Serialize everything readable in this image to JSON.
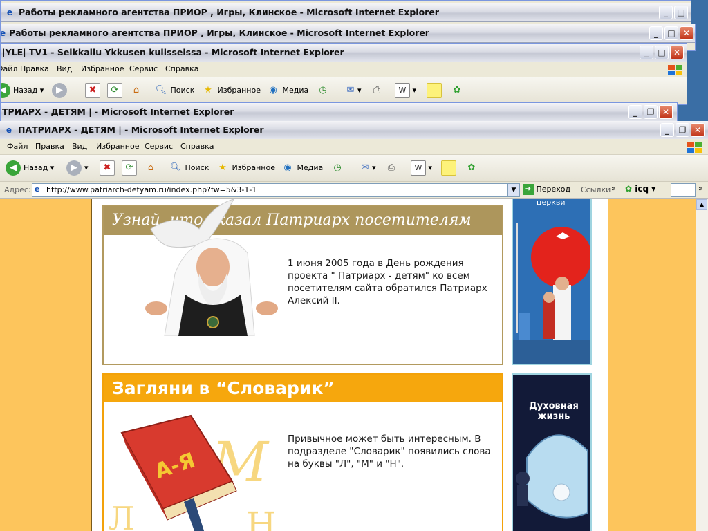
{
  "windows": {
    "w1": {
      "title": "Работы рекламного агентства ПРИОР , Игры, Клинское - Microsoft Internet Explorer"
    },
    "w2": {
      "title": "Работы рекламного агентства ПРИОР , Игры, Клинское - Microsoft Internet Explorer"
    },
    "w3": {
      "title": "|YLE| TV1 - Seikkailu Ykkusen kulisseissa - Microsoft Internet Explorer"
    },
    "w4": {
      "title": "ТРИАРХ - ДЕТЯМ | - Microsoft Internet Explorer"
    },
    "w5": {
      "title": "ПАТРИАРХ - ДЕТЯМ | - Microsoft Internet Explorer"
    }
  },
  "menu": {
    "file": "Файл",
    "edit": "Правка",
    "view": "Вид",
    "favorites": "Избранное",
    "tools": "Сервис",
    "help": "Справка"
  },
  "toolbar": {
    "back": "Назад",
    "search": "Поиск",
    "favorites": "Избранное",
    "media": "Медиа"
  },
  "address": {
    "label": "Адрес:",
    "url": "http://www.patriarch-detyam.ru/index.php?fw=5&3-1-1",
    "go": "Переход",
    "links": "Ссылки",
    "icq": "icq"
  },
  "content": {
    "block1": {
      "heading": "Узнай, что сказал Патриарх посетителям сайта",
      "text": "1 июня 2005 года в День рождения проекта \" Патриарх - детям\" ко всем посетителям сайта обратился Патриарх Алексий II."
    },
    "block2": {
      "heading": "Загляни в “Словарик”",
      "text": "Привычное может быть интересным. В подразделе \"Словарик\" появились слова на буквы \"Л\", \"М\" и \"Н\".",
      "book_letters": "А-Я"
    },
    "banner1": {
      "caption": "церкви"
    },
    "banner2": {
      "caption": "Духовная жизнь"
    }
  },
  "colors": {
    "accent_brown": "#ad965c",
    "accent_orange": "#f6a70d",
    "page_bg": "#fdc55c"
  }
}
